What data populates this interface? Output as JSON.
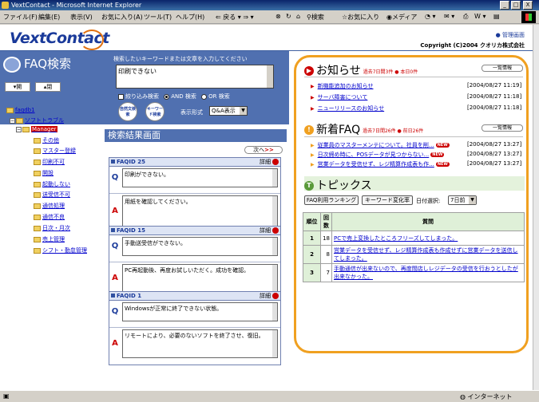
{
  "window": {
    "title": "VextContact - Microsoft Internet Explorer",
    "controls": [
      "_",
      "□",
      "X"
    ]
  },
  "menubar": {
    "items": [
      "ファイル(F)",
      "編集(E)",
      "表示(V)",
      "お気に入り(A)",
      "ツール(T)",
      "ヘルプ(H)"
    ],
    "back": "戻る",
    "search": "検索",
    "favorites": "お気に入り",
    "media": "メディア"
  },
  "header": {
    "logo": "VextContact",
    "admin_link": "管理画面",
    "copyright": "Copyright (C)2004 クオリカ株式会社"
  },
  "search": {
    "title": "FAQ検索",
    "hint": "検索したいキーワードまたは文章を入力してください",
    "query": "印刷できない",
    "narrow_label": "絞り込み検索",
    "and_label": "AND 検索",
    "or_label": "OR 検索",
    "natural_btn": "自然文検索",
    "keyword_btn": "キーワード検索",
    "format_label": "表示形式",
    "format_value": "Q&A表示"
  },
  "tree": {
    "open_btn": "開",
    "close_btn": "閉",
    "nodes": [
      "faqdb1",
      "ソフトトラブル",
      "Manager",
      "その他",
      "マスター登録",
      "印刷不可",
      "開設",
      "起動しない",
      "送受信不可",
      "通信処理",
      "通信不良",
      "日次・月次",
      "売上管理",
      "シフト・勤怠管理"
    ]
  },
  "results": {
    "heading": "検索結果画面",
    "next_label": "次へ",
    "detail_label": "詳細",
    "items": [
      {
        "id": "FAQID 25",
        "q": "印刷ができない。",
        "a": "用紙を確認してください。"
      },
      {
        "id": "FAQID 15",
        "q": "手動送受信ができない。",
        "a": "PC再起動後、再度お試しいただく。成功を確認。"
      },
      {
        "id": "FAQID 1",
        "q": "Windowsが正常に終了できない状態。",
        "a": "リモートにより、必要のないソフトを終了させ、復旧。"
      }
    ]
  },
  "notices": {
    "title": "お知らせ",
    "sub": "過去7日間3件 ● 本日0件",
    "list_btn": "一覧情報",
    "items": [
      {
        "label": "新機能追加のお知らせ",
        "date": "[2004/08/27 11:19]"
      },
      {
        "label": "サーバ障害について",
        "date": "[2004/08/27 11:18]"
      },
      {
        "label": "ニューリリースのお知らせ",
        "date": "[2004/08/27 11:18]"
      }
    ]
  },
  "newfaq": {
    "title": "新着FAQ",
    "sub": "過去7日間26件 ● 前日26件",
    "list_btn": "一覧情報",
    "new_badge": "NEW",
    "items": [
      {
        "label": "従業員のマスターメンテについて。社員を削...",
        "date": "[2004/08/27 13:27]"
      },
      {
        "label": "日次締め時に、POSデータが見つからない...",
        "date": "[2004/08/27 13:27]"
      },
      {
        "label": "営業データを受信せず、レジ精算作成表も作...",
        "date": "[2004/08/27 13:27]"
      }
    ]
  },
  "topics": {
    "title": "トピックス",
    "btn_usage": "FAQ利用ランキング",
    "btn_keyword": "キーワード変化率",
    "date_label": "日付選択:",
    "date_value": "7日前",
    "col_rank": "順位",
    "col_count": "回数",
    "col_question": "質問",
    "rows": [
      {
        "rank": "1",
        "count": "18",
        "q": "PCで売上変換したところフリーズしてしまった。"
      },
      {
        "rank": "2",
        "count": "8",
        "q": "営業データを受信せず、レジ精算作成表も作成せずに営業データを送信してしまった。"
      },
      {
        "rank": "3",
        "count": "7",
        "q": "手動通信が出来ないので、再度間店しレジデータの受信を行おうとしたが出来なかった。"
      }
    ]
  },
  "status": {
    "zone": "インターネット"
  }
}
